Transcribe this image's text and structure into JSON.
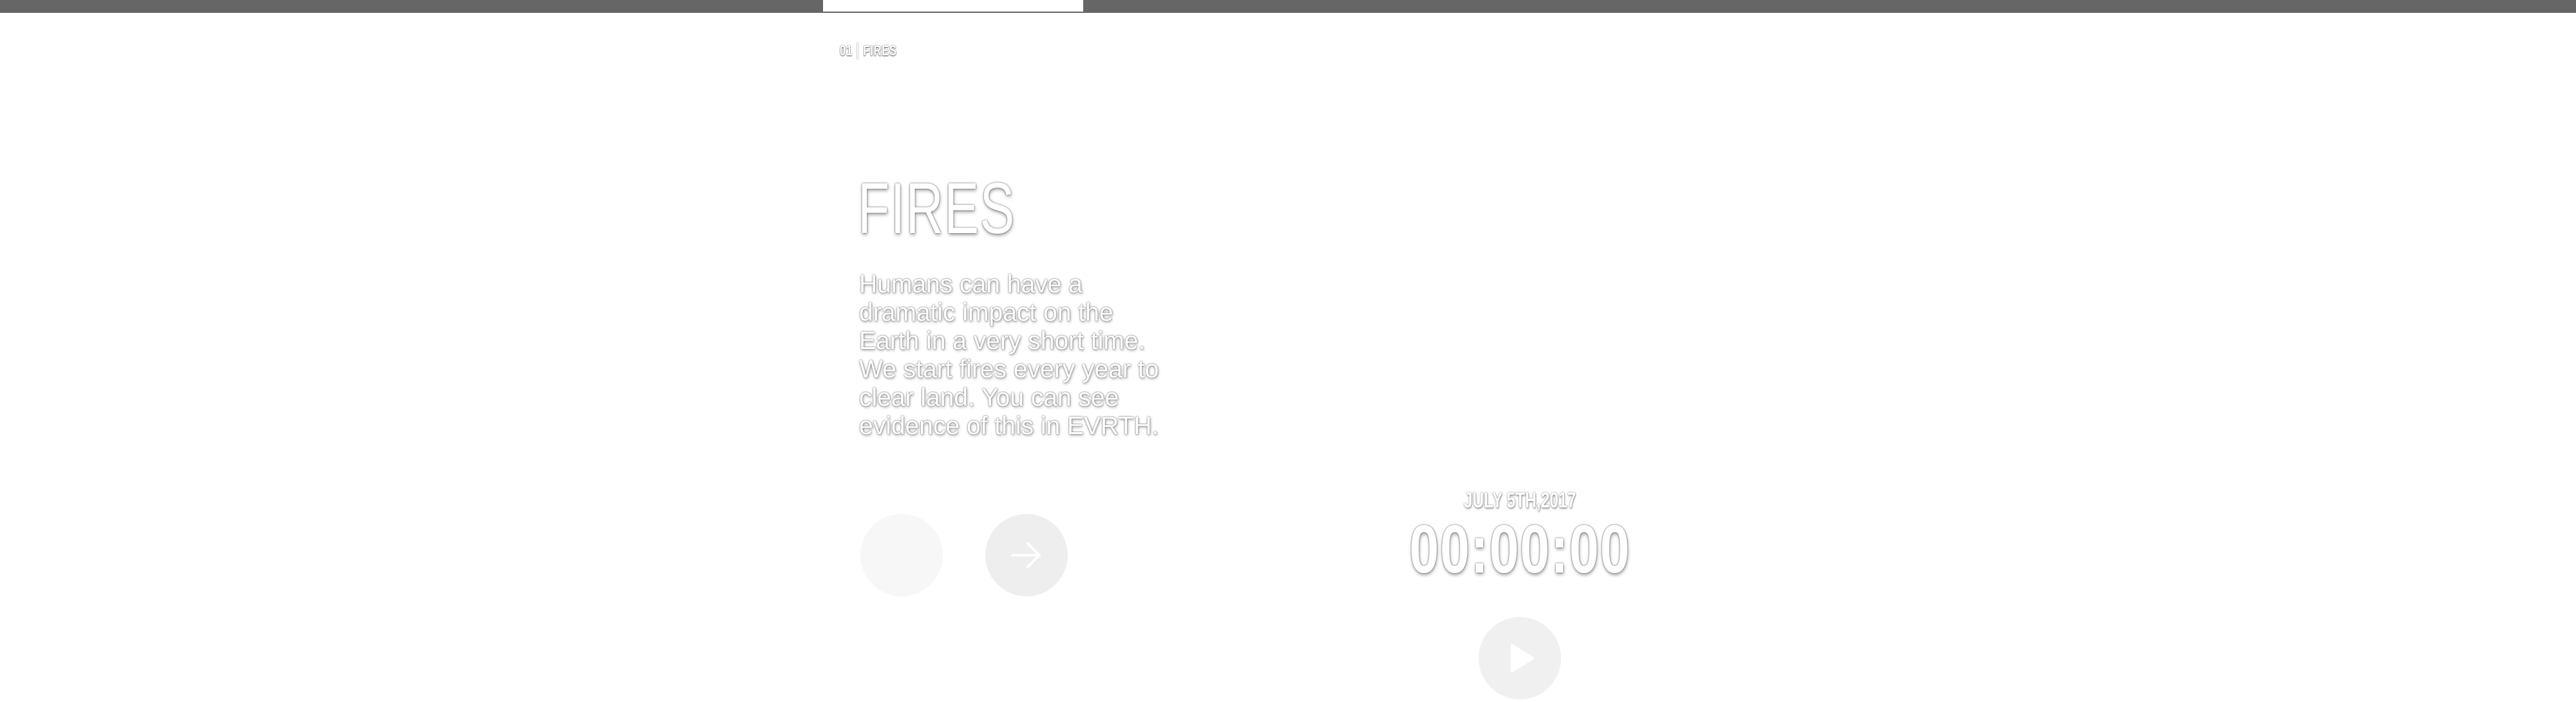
{
  "header": {
    "tab_active": true
  },
  "breadcrumb": {
    "number": "01",
    "section": "FIRES"
  },
  "main": {
    "title": "FIRES",
    "description": "Humans can have a dramatic impact on the Earth in a very short time. We start fires every year to clear land. You can see evidence of this in EVRTH."
  },
  "nav": {
    "prev_icon": "blank-circle",
    "next_icon": "arrow-right-icon"
  },
  "player": {
    "date": "JULY 5TH,2017",
    "timer": "00:00:00",
    "play_icon": "play-icon"
  },
  "colors": {
    "top_bar": "#666666",
    "background": "#ffffff",
    "button_fill": "#eeeeee"
  }
}
